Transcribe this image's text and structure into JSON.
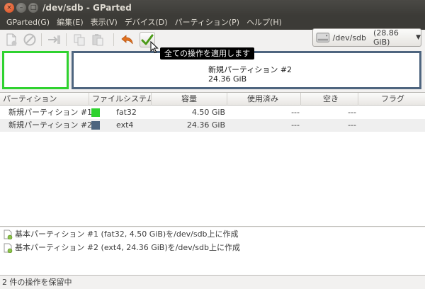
{
  "window": {
    "title": "/dev/sdb - GParted",
    "close_glyph": "×",
    "minimize_glyph": "–",
    "maximize_glyph": "□"
  },
  "menu": [
    "GParted(G)",
    "編集(E)",
    "表示(V)",
    "デバイス(D)",
    "パーティション(P)",
    "ヘルプ(H)"
  ],
  "toolbar": {
    "buttons": [
      "new-partition-icon",
      "delete-icon",
      "resize-move-icon",
      "copy-icon",
      "paste-icon",
      "undo-icon",
      "apply-all-icon"
    ],
    "tooltip": "全ての操作を適用します"
  },
  "device": {
    "path": "/dev/sdb",
    "size": "(28.86 GiB)"
  },
  "diskmap": {
    "partition1": {
      "color": "#2fd22f"
    },
    "partition2": {
      "name": "新規パーティション #2",
      "size": "24.36 GiB",
      "color": "#4e657f"
    }
  },
  "table": {
    "headers": [
      "パーティション",
      "ファイルシステム",
      "容量",
      "使用済み",
      "空き",
      "フラグ"
    ],
    "rows": [
      {
        "partition": "新規パーティション #1",
        "fs_color": "#2fd22f",
        "filesystem": "fat32",
        "size": "4.50 GiB",
        "used": "---",
        "free": "---",
        "flags": ""
      },
      {
        "partition": "新規パーティション #2",
        "fs_color": "#4e657f",
        "filesystem": "ext4",
        "size": "24.36 GiB",
        "used": "---",
        "free": "---",
        "flags": ""
      }
    ]
  },
  "operations": [
    "基本パーティション #1 (fat32, 4.50 GiB)を/dev/sdb上に作成",
    "基本パーティション #2 (ext4, 24.36 GiB)を/dev/sdb上に作成"
  ],
  "status": "2 件の操作を保留中"
}
